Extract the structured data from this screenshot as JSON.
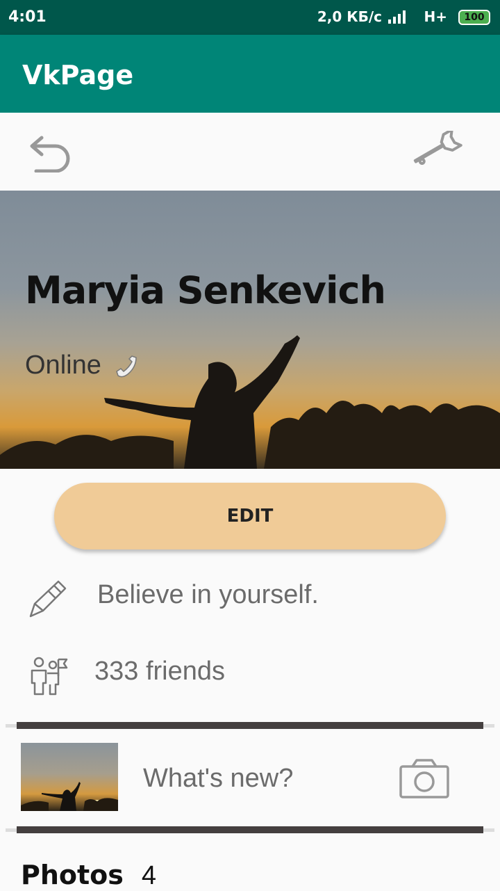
{
  "status_bar": {
    "time": "4:01",
    "net_speed": "2,0 КБ/с",
    "network_type": "H+",
    "battery": "100"
  },
  "app_bar": {
    "title": "VkPage"
  },
  "toolbar": {
    "back_icon": "back-arrow-icon",
    "settings_icon": "wrench-icon"
  },
  "profile": {
    "name": "Maryia Senkevich",
    "status": "Online",
    "status_icon": "phone-icon"
  },
  "edit_label": "EDIT",
  "about": {
    "status_text": "Believe in yourself.",
    "icon": "pencil-icon"
  },
  "friends": {
    "text": "333 friends",
    "icon": "friends-icon"
  },
  "post": {
    "placeholder": "What's new?",
    "icon": "camera-icon"
  },
  "photos": {
    "label": "Photos",
    "count": "4"
  },
  "colors": {
    "app_bar": "#008577",
    "status_bar": "#00574b",
    "edit_button": "#f0cb97",
    "divider": "#443f3f"
  }
}
